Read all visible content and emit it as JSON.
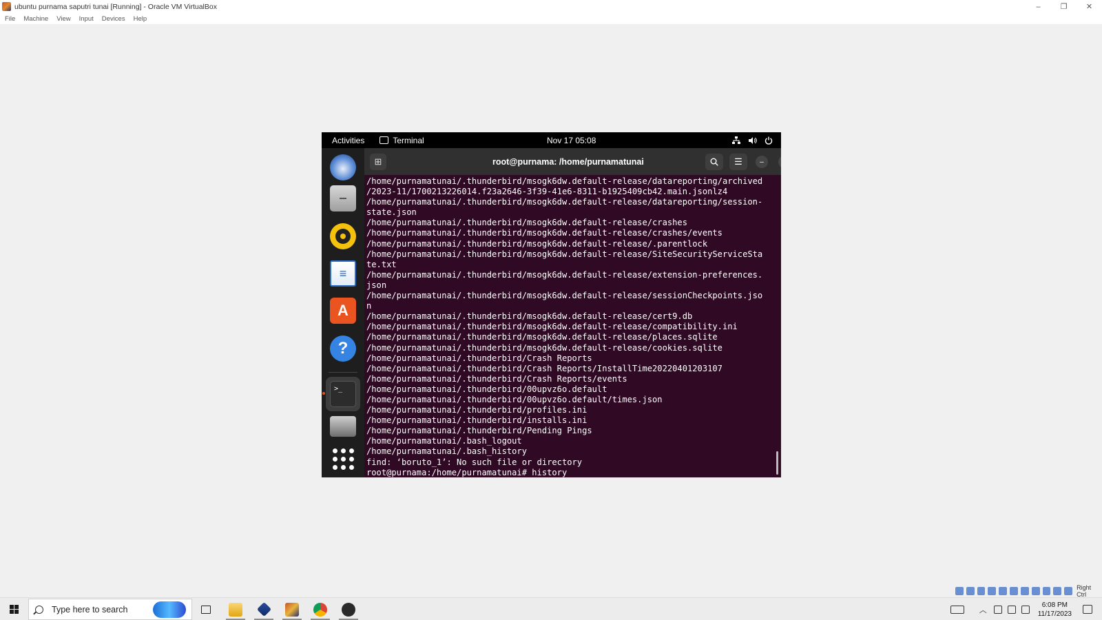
{
  "host": {
    "window_title": "ubuntu purnama saputri tunai [Running] - Oracle VM VirtualBox",
    "menu": [
      "File",
      "Machine",
      "View",
      "Input",
      "Devices",
      "Help"
    ],
    "controls": {
      "minimize": "–",
      "restore": "❐",
      "close": "✕"
    },
    "status_host_key": "Right Ctrl"
  },
  "gnome": {
    "activities": "Activities",
    "app_menu": "Terminal",
    "clock": "Nov 17  05:08"
  },
  "terminal": {
    "title": "root@purnama: /home/purnamatunai",
    "lines": [
      "/home/purnamatunai/.thunderbird/msogk6dw.default-release/datareporting/archived",
      "/2023-11/1700213226014.f23a2646-3f39-41e6-8311-b1925409cb42.main.jsonlz4",
      "/home/purnamatunai/.thunderbird/msogk6dw.default-release/datareporting/session-",
      "state.json",
      "/home/purnamatunai/.thunderbird/msogk6dw.default-release/crashes",
      "/home/purnamatunai/.thunderbird/msogk6dw.default-release/crashes/events",
      "/home/purnamatunai/.thunderbird/msogk6dw.default-release/.parentlock",
      "/home/purnamatunai/.thunderbird/msogk6dw.default-release/SiteSecurityServiceSta",
      "te.txt",
      "/home/purnamatunai/.thunderbird/msogk6dw.default-release/extension-preferences.",
      "json",
      "/home/purnamatunai/.thunderbird/msogk6dw.default-release/sessionCheckpoints.jso",
      "n",
      "/home/purnamatunai/.thunderbird/msogk6dw.default-release/cert9.db",
      "/home/purnamatunai/.thunderbird/msogk6dw.default-release/compatibility.ini",
      "/home/purnamatunai/.thunderbird/msogk6dw.default-release/places.sqlite",
      "/home/purnamatunai/.thunderbird/msogk6dw.default-release/cookies.sqlite",
      "/home/purnamatunai/.thunderbird/Crash Reports",
      "/home/purnamatunai/.thunderbird/Crash Reports/InstallTime20220401203107",
      "/home/purnamatunai/.thunderbird/Crash Reports/events",
      "/home/purnamatunai/.thunderbird/00upvz6o.default",
      "/home/purnamatunai/.thunderbird/00upvz6o.default/times.json",
      "/home/purnamatunai/.thunderbird/profiles.ini",
      "/home/purnamatunai/.thunderbird/installs.ini",
      "/home/purnamatunai/.thunderbird/Pending Pings",
      "/home/purnamatunai/.bash_logout",
      "/home/purnamatunai/.bash_history",
      "find: ‘boruto_1’: No such file or directory",
      "root@purnama:/home/purnamatunai# history"
    ]
  },
  "taskbar": {
    "search_placeholder": "Type here to search",
    "time": "6:08 PM",
    "date": "11/17/2023"
  },
  "colors": {
    "terminal_bg": "#300a24",
    "ubuntu_orange": "#e95420"
  }
}
